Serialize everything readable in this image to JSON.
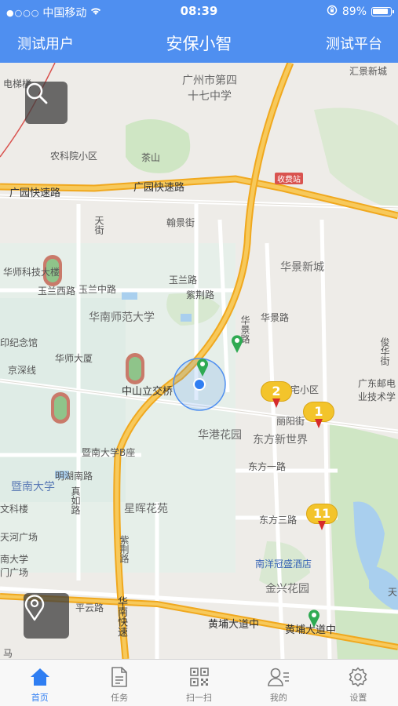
{
  "status_bar": {
    "signal": "●○○○",
    "carrier": "中国移动",
    "time": "08:39",
    "battery": "89%"
  },
  "nav": {
    "left": "测试用户",
    "title": "安保小智",
    "right": "测试平台"
  },
  "map": {
    "labels": {
      "school": "广州市第四\n十七中学",
      "nongke": "农科院小区",
      "chashan": "茶山",
      "huijing": "汇景新城",
      "guangyuan1": "广园快速路",
      "guangyuan2": "广园快速路",
      "shoufei": "收费站",
      "hanjing": "翰景街",
      "tianjie": "天街",
      "huajing": "华景新城",
      "huashi_keji": "华师科技大楼",
      "yulan_w": "玉兰西路",
      "yulan_m": "玉兰中路",
      "yulan_r": "玉兰路",
      "zijing": "紫荆路",
      "huanan_sf": "华南师范大学",
      "huajing_rd": "华景路",
      "huajing_rd2": "华景路",
      "jinian": "中山纪念馆",
      "huashi_dasha": "华师大厦",
      "jingshen": "京深线",
      "zhongshan_bridge": "中山立交桥",
      "zhaixiaoqu": "宅小区",
      "youdian": "广东邮电\n业技术学",
      "junjie": "俊华街",
      "lijing": "丽阳街",
      "huagang": "华港花园",
      "dongfang": "东方新世界",
      "dongfang1": "东方一路",
      "jinan_b": "暨南大学B座",
      "mingnan": "明湖南路",
      "zhenjiu": "真如路",
      "jinan": "暨南大学",
      "wenke": "文科楼",
      "xinghui": "星晖花苑",
      "dongfang3": "东方三路",
      "nanyang": "南洋冠盛酒店",
      "jinxing": "金兴花园",
      "ziyun": "紫荆路",
      "huanankuaisu": "华南快速",
      "pingyun": "平云路",
      "huangpu1": "黄埔大道中",
      "huangpu2": "黄埔大道中",
      "tianhe_guang": "天河广场",
      "jinan_gate": "南大学\n门广场",
      "ma": "马",
      "dianjilou": "电梯楼",
      "tian": "天",
      "zhongshan_guan": "印纪念馆"
    },
    "clusters": [
      {
        "count": "2"
      },
      {
        "count": "1"
      },
      {
        "count": "11"
      }
    ],
    "search_icon": "search-icon",
    "locate_icon": "location-pin-icon",
    "colors": {
      "highway": "#f0a81e",
      "road": "#ffffff",
      "green": "#cfe6c4",
      "water": "#a9cfee",
      "accent": "#4f8ff0"
    }
  },
  "tabs": [
    {
      "label": "首页",
      "icon": "home-icon",
      "active": true
    },
    {
      "label": "任务",
      "icon": "document-icon",
      "active": false
    },
    {
      "label": "扫一扫",
      "icon": "qr-code-icon",
      "active": false
    },
    {
      "label": "我的",
      "icon": "user-icon",
      "active": false
    },
    {
      "label": "设置",
      "icon": "gear-icon",
      "active": false
    }
  ]
}
